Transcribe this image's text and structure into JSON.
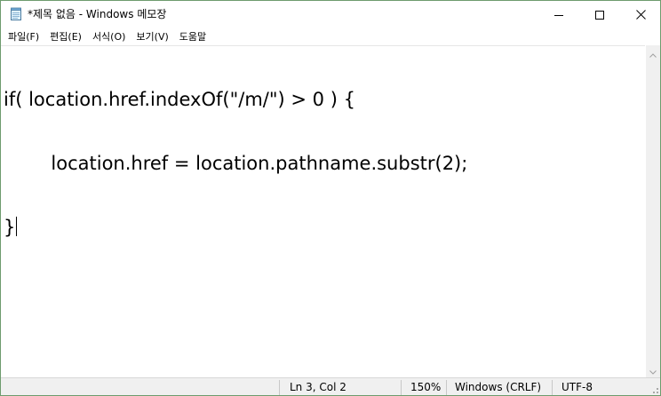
{
  "window": {
    "title": "*제목 없음 - Windows 메모장",
    "app_icon": "notepad-icon",
    "controls": {
      "minimize_icon": "minimize-icon",
      "maximize_icon": "maximize-icon",
      "close_icon": "close-icon"
    }
  },
  "menubar": {
    "items": [
      {
        "label": "파일(F)"
      },
      {
        "label": "편집(E)"
      },
      {
        "label": "서식(O)"
      },
      {
        "label": "보기(V)"
      },
      {
        "label": "도움말"
      }
    ]
  },
  "editor": {
    "lines": [
      "if( location.href.indexOf(\"/m/\") > 0 ) {",
      "        location.href = location.pathname.substr(2);",
      "}"
    ]
  },
  "statusbar": {
    "position": "Ln 3, Col 2",
    "zoom": "150%",
    "line_ending": "Windows (CRLF)",
    "encoding": "UTF-8"
  },
  "colors": {
    "window_border": "#6e9c6e",
    "statusbar_bg": "#f0f0f0"
  }
}
